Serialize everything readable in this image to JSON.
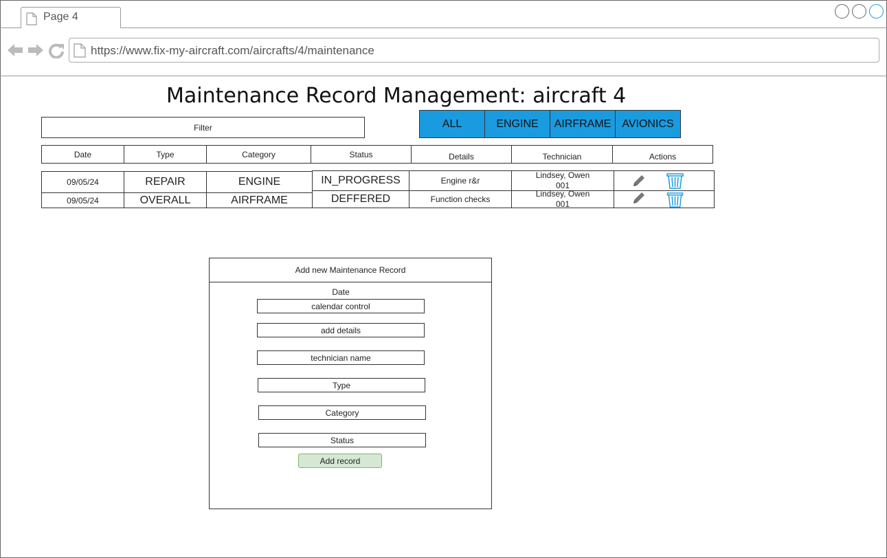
{
  "browser": {
    "tab_title": "Page 4",
    "url": "https://www.fix-my-aircraft.com/aircrafts/4/maintenance"
  },
  "page": {
    "title": "Maintenance Record Management: aircraft 4",
    "filter_placeholder": "Filter",
    "category_buttons": [
      "ALL",
      "ENGINE",
      "AIRFRAME",
      "AVIONICS"
    ],
    "accent_color": "#1a9be0"
  },
  "table": {
    "columns": [
      "Date",
      "Type",
      "Category",
      "Status",
      "Details",
      "Technician",
      "Actions"
    ],
    "rows": [
      {
        "date": "09/05/24",
        "type": "REPAIR",
        "category": "ENGINE",
        "status": "IN_PROGRESS",
        "details": "Engine r&r",
        "technician_name": "Lindsey, Owen",
        "technician_id": "001",
        "actions": [
          "pencil-icon",
          "trash-icon"
        ]
      },
      {
        "date": "09/05/24",
        "type": "OVERALL",
        "category": "AIRFRAME",
        "status": "DEFFERED",
        "details": "Function checks",
        "technician_name": "Lindsey, Owen",
        "technician_id": "001",
        "actions": [
          "pencil-icon",
          "trash-icon"
        ]
      }
    ]
  },
  "form": {
    "title": "Add new Maintenance Record",
    "date_label": "Date",
    "fields": [
      "calendar control",
      "add details",
      "technician name",
      "Type",
      "Category",
      "Status"
    ],
    "submit_label": "Add record",
    "submit_color": "#d5e8d4"
  }
}
